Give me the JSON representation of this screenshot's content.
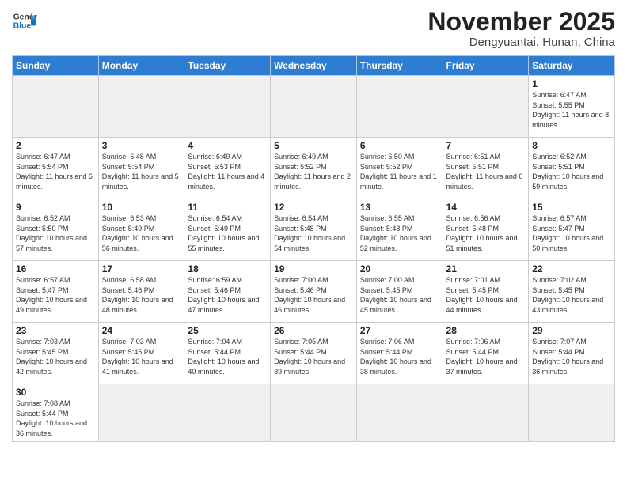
{
  "header": {
    "logo_general": "General",
    "logo_blue": "Blue",
    "month_title": "November 2025",
    "subtitle": "Dengyuantai, Hunan, China"
  },
  "weekdays": [
    "Sunday",
    "Monday",
    "Tuesday",
    "Wednesday",
    "Thursday",
    "Friday",
    "Saturday"
  ],
  "weeks": [
    [
      {
        "day": "",
        "empty": true
      },
      {
        "day": "",
        "empty": true
      },
      {
        "day": "",
        "empty": true
      },
      {
        "day": "",
        "empty": true
      },
      {
        "day": "",
        "empty": true
      },
      {
        "day": "",
        "empty": true
      },
      {
        "day": "1",
        "sunrise": "6:47 AM",
        "sunset": "5:55 PM",
        "daylight": "11 hours and 8 minutes."
      }
    ],
    [
      {
        "day": "2",
        "sunrise": "6:47 AM",
        "sunset": "5:54 PM",
        "daylight": "11 hours and 6 minutes."
      },
      {
        "day": "3",
        "sunrise": "6:48 AM",
        "sunset": "5:54 PM",
        "daylight": "11 hours and 5 minutes."
      },
      {
        "day": "4",
        "sunrise": "6:49 AM",
        "sunset": "5:53 PM",
        "daylight": "11 hours and 4 minutes."
      },
      {
        "day": "5",
        "sunrise": "6:49 AM",
        "sunset": "5:52 PM",
        "daylight": "11 hours and 2 minutes."
      },
      {
        "day": "6",
        "sunrise": "6:50 AM",
        "sunset": "5:52 PM",
        "daylight": "11 hours and 1 minute."
      },
      {
        "day": "7",
        "sunrise": "6:51 AM",
        "sunset": "5:51 PM",
        "daylight": "11 hours and 0 minutes."
      },
      {
        "day": "8",
        "sunrise": "6:52 AM",
        "sunset": "5:51 PM",
        "daylight": "10 hours and 59 minutes."
      }
    ],
    [
      {
        "day": "9",
        "sunrise": "6:52 AM",
        "sunset": "5:50 PM",
        "daylight": "10 hours and 57 minutes."
      },
      {
        "day": "10",
        "sunrise": "6:53 AM",
        "sunset": "5:49 PM",
        "daylight": "10 hours and 56 minutes."
      },
      {
        "day": "11",
        "sunrise": "6:54 AM",
        "sunset": "5:49 PM",
        "daylight": "10 hours and 55 minutes."
      },
      {
        "day": "12",
        "sunrise": "6:54 AM",
        "sunset": "5:48 PM",
        "daylight": "10 hours and 54 minutes."
      },
      {
        "day": "13",
        "sunrise": "6:55 AM",
        "sunset": "5:48 PM",
        "daylight": "10 hours and 52 minutes."
      },
      {
        "day": "14",
        "sunrise": "6:56 AM",
        "sunset": "5:48 PM",
        "daylight": "10 hours and 51 minutes."
      },
      {
        "day": "15",
        "sunrise": "6:57 AM",
        "sunset": "5:47 PM",
        "daylight": "10 hours and 50 minutes."
      }
    ],
    [
      {
        "day": "16",
        "sunrise": "6:57 AM",
        "sunset": "5:47 PM",
        "daylight": "10 hours and 49 minutes."
      },
      {
        "day": "17",
        "sunrise": "6:58 AM",
        "sunset": "5:46 PM",
        "daylight": "10 hours and 48 minutes."
      },
      {
        "day": "18",
        "sunrise": "6:59 AM",
        "sunset": "5:46 PM",
        "daylight": "10 hours and 47 minutes."
      },
      {
        "day": "19",
        "sunrise": "7:00 AM",
        "sunset": "5:46 PM",
        "daylight": "10 hours and 46 minutes."
      },
      {
        "day": "20",
        "sunrise": "7:00 AM",
        "sunset": "5:45 PM",
        "daylight": "10 hours and 45 minutes."
      },
      {
        "day": "21",
        "sunrise": "7:01 AM",
        "sunset": "5:45 PM",
        "daylight": "10 hours and 44 minutes."
      },
      {
        "day": "22",
        "sunrise": "7:02 AM",
        "sunset": "5:45 PM",
        "daylight": "10 hours and 43 minutes."
      }
    ],
    [
      {
        "day": "23",
        "sunrise": "7:03 AM",
        "sunset": "5:45 PM",
        "daylight": "10 hours and 42 minutes."
      },
      {
        "day": "24",
        "sunrise": "7:03 AM",
        "sunset": "5:45 PM",
        "daylight": "10 hours and 41 minutes."
      },
      {
        "day": "25",
        "sunrise": "7:04 AM",
        "sunset": "5:44 PM",
        "daylight": "10 hours and 40 minutes."
      },
      {
        "day": "26",
        "sunrise": "7:05 AM",
        "sunset": "5:44 PM",
        "daylight": "10 hours and 39 minutes."
      },
      {
        "day": "27",
        "sunrise": "7:06 AM",
        "sunset": "5:44 PM",
        "daylight": "10 hours and 38 minutes."
      },
      {
        "day": "28",
        "sunrise": "7:06 AM",
        "sunset": "5:44 PM",
        "daylight": "10 hours and 37 minutes."
      },
      {
        "day": "29",
        "sunrise": "7:07 AM",
        "sunset": "5:44 PM",
        "daylight": "10 hours and 36 minutes."
      }
    ],
    [
      {
        "day": "30",
        "sunrise": "7:08 AM",
        "sunset": "5:44 PM",
        "daylight": "10 hours and 36 minutes."
      },
      {
        "day": "",
        "empty": true
      },
      {
        "day": "",
        "empty": true
      },
      {
        "day": "",
        "empty": true
      },
      {
        "day": "",
        "empty": true
      },
      {
        "day": "",
        "empty": true
      },
      {
        "day": "",
        "empty": true
      }
    ]
  ]
}
